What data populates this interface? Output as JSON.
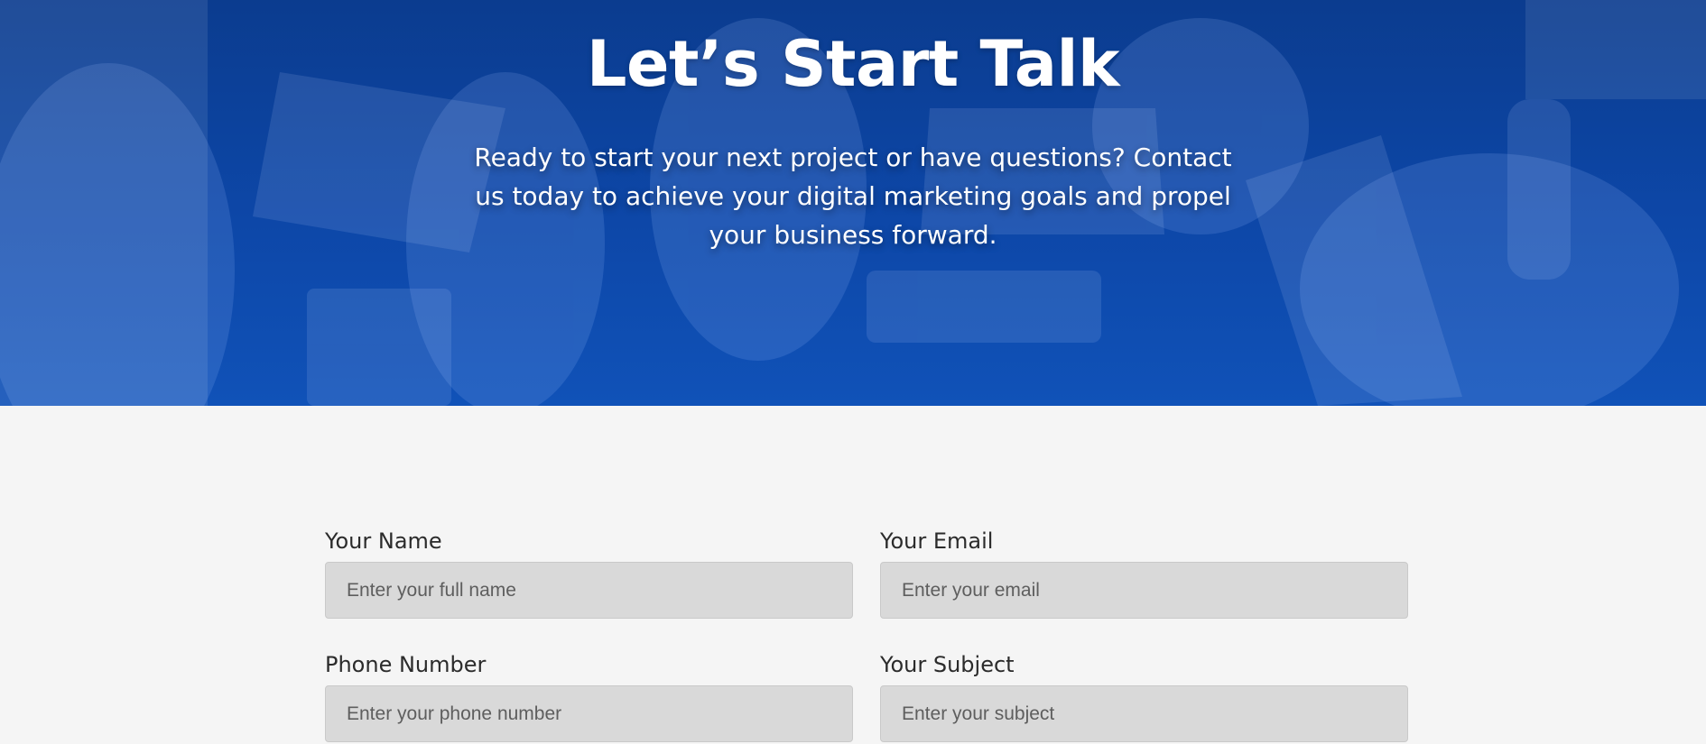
{
  "hero": {
    "title": "Let’s Start Talk",
    "description": "Ready to start your next project or have questions? Contact us today to achieve your digital marketing goals and propel your business forward."
  },
  "form": {
    "name": {
      "label": "Your Name",
      "placeholder": "Enter your full name"
    },
    "email": {
      "label": "Your Email",
      "placeholder": "Enter your email"
    },
    "phone": {
      "label": "Phone Number",
      "placeholder": "Enter your phone number"
    },
    "subject": {
      "label": "Your Subject",
      "placeholder": "Enter your subject"
    }
  },
  "colors": {
    "hero_blue": "#0d47a8",
    "page_background": "#f5f5f5",
    "input_background": "#d9d9d9"
  }
}
